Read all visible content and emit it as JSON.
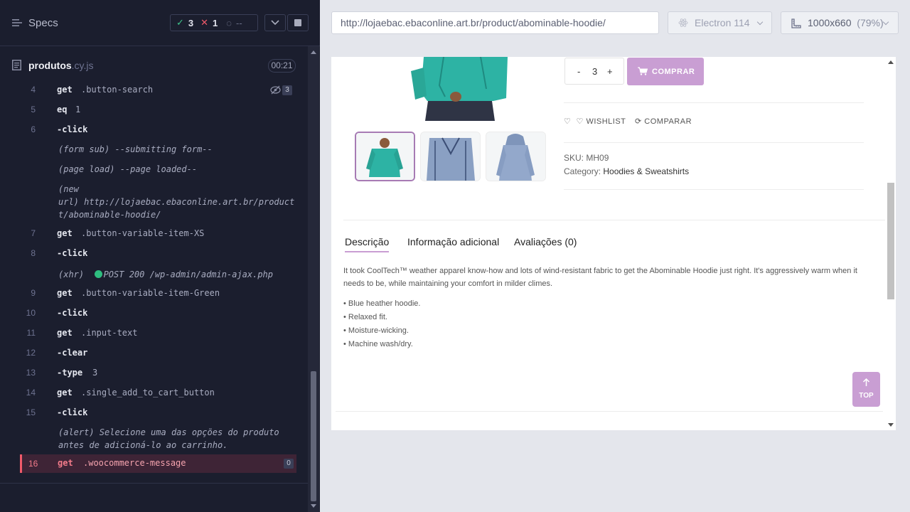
{
  "reporter": {
    "specs_label": "Specs",
    "stats": {
      "passed": "3",
      "failed": "1",
      "pending": "--"
    },
    "spec_file": {
      "name": "produtos",
      "ext": ".cy.js",
      "duration": "00:21"
    }
  },
  "commands": [
    {
      "num": "4",
      "name": "get",
      "arg": ".button-search",
      "badge": "3"
    },
    {
      "num": "5",
      "name": "eq",
      "arg": "1"
    },
    {
      "num": "6",
      "name": "-click",
      "arg": ""
    },
    {
      "sub": "(form sub)  --submitting form--"
    },
    {
      "sub": "(page load)  --page loaded--"
    },
    {
      "sub_line1": "(new",
      "sub_line2": "url)  http://lojaebac.ebaconline.art.br/product",
      "sub_line3": "t/abominable-hoodie/"
    },
    {
      "num": "7",
      "name": "get",
      "arg": ".button-variable-item-XS"
    },
    {
      "num": "8",
      "name": "-click",
      "arg": ""
    },
    {
      "xhr_prefix": "(xhr)",
      "xhr_text": "POST 200 /wp-admin/admin-ajax.php"
    },
    {
      "num": "9",
      "name": "get",
      "arg": ".button-variable-item-Green"
    },
    {
      "num": "10",
      "name": "-click",
      "arg": ""
    },
    {
      "num": "11",
      "name": "get",
      "arg": ".input-text"
    },
    {
      "num": "12",
      "name": "-clear",
      "arg": ""
    },
    {
      "num": "13",
      "name": "-type",
      "arg": "3"
    },
    {
      "num": "14",
      "name": "get",
      "arg": ".single_add_to_cart_button"
    },
    {
      "num": "15",
      "name": "-click",
      "arg": ""
    },
    {
      "alert_line1": "(alert)  Selecione uma das opções do produto",
      "alert_line2": "antes de adicioná-lo ao carrinho."
    },
    {
      "num": "16",
      "name": "get",
      "arg": ".woocommerce-message",
      "badge": "0",
      "state": "failed"
    }
  ],
  "browser": {
    "url": "http://lojaebac.ebaconline.art.br/product/abominable-hoodie/",
    "browser_name": "Electron 114",
    "viewport": "1000x660",
    "zoom": "(79%)"
  },
  "product": {
    "qty_minus": "-",
    "qty_value": "3",
    "qty_plus": "+",
    "buy_label": "COMPRAR",
    "wishlist_label": "WISHLIST",
    "compare_label": "COMPARAR",
    "sku_label": "SKU:",
    "sku_value": "MH09",
    "category_label": "Category:",
    "category_value": "Hoodies & Sweatshirts",
    "tabs": [
      "Descrição",
      "Informação adicional",
      "Avaliações (0)"
    ],
    "description": "It took CoolTech™ weather apparel know-how and lots of wind-resistant fabric to get the Abominable Hoodie just right. It's aggressively warm when it needs to be, while maintaining your comfort in milder climes.",
    "bullets": [
      "• Blue heather hoodie.",
      "• Relaxed fit.",
      "• Moisture-wicking.",
      "• Machine wash/dry."
    ],
    "top_label": "TOP"
  },
  "colors": {
    "accent": "#c99ed3",
    "pass": "#3ec38b",
    "fail": "#f05a6a",
    "panel_bg": "#1b1e2e"
  }
}
